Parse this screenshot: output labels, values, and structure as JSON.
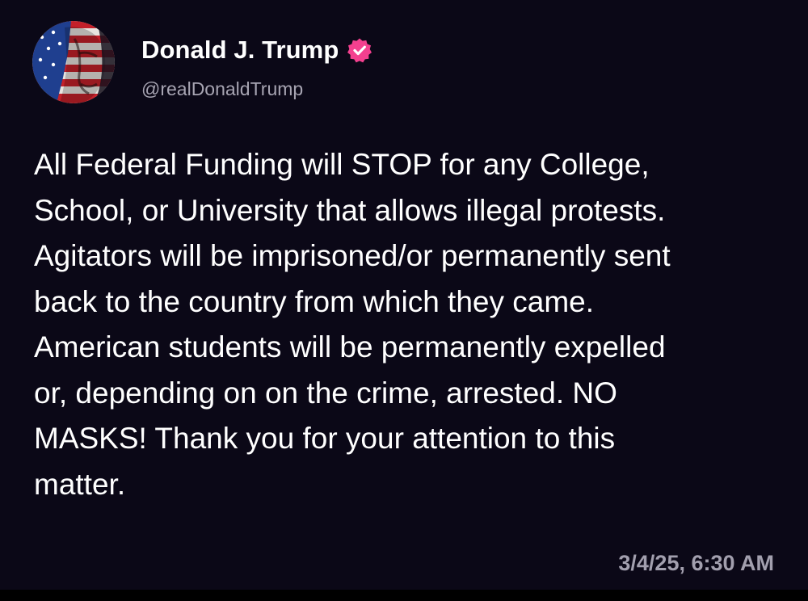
{
  "post": {
    "author": {
      "display_name": "Donald J. Trump",
      "handle": "@realDonaldTrump",
      "verified_icon": "verified-badge-icon",
      "verified_color": "#f4408f",
      "avatar_icon": "profile-avatar"
    },
    "body_lines": [
      "All Federal Funding will STOP for any College,",
      "School, or University that allows illegal protests.",
      "Agitators will be imprisoned/or permanently sent",
      "back to the country from which they came.",
      "American students will be permanently expelled",
      "or, depending on on the crime, arrested. NO",
      "MASKS! Thank you for your attention to this",
      "matter."
    ],
    "timestamp": "3/4/25, 6:30 AM"
  },
  "colors": {
    "background": "#0b0817",
    "text": "#ffffff",
    "secondary_text": "#a7a4b2"
  }
}
